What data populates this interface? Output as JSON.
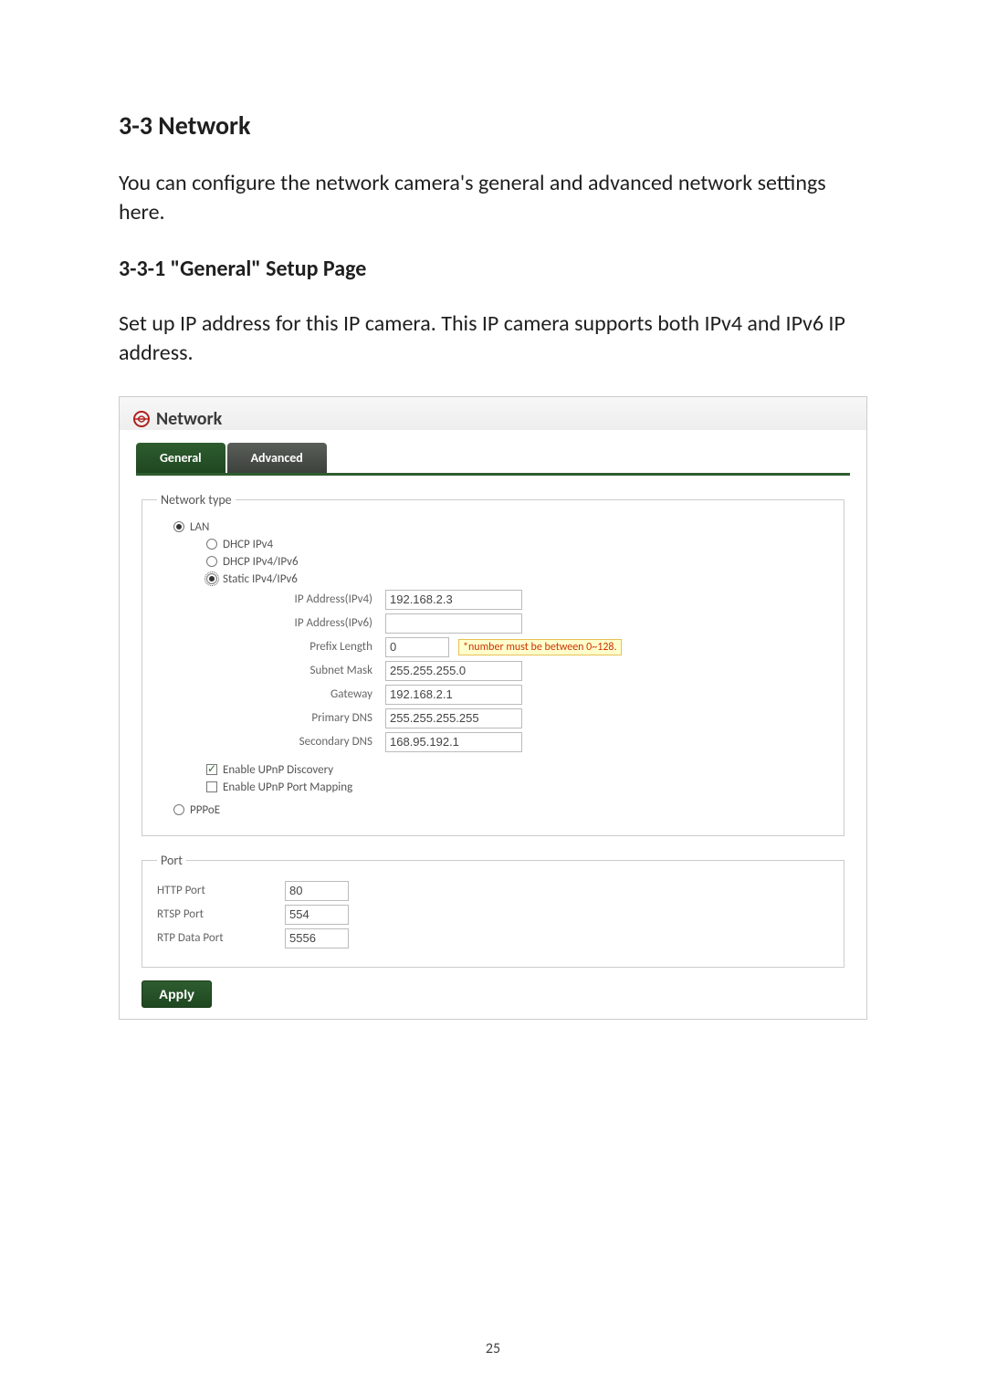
{
  "doc": {
    "section_heading": "3-3 Network",
    "intro": "You can configure the network camera's general and advanced network settings here.",
    "sub_heading": "3-3-1 \"General\" Setup Page",
    "sub_intro": "Set up IP address for this IP camera. This IP camera supports both IPv4 and IPv6 IP address.",
    "page_number": "25"
  },
  "panel": {
    "title": "Network",
    "tabs": {
      "general": "General",
      "advanced": "Advanced"
    }
  },
  "network_type": {
    "legend": "Network type",
    "lan": "LAN",
    "dhcp_ipv4": "DHCP IPv4",
    "dhcp_ipv4_ipv6": "DHCP IPv4/IPv6",
    "static_ipv4_ipv6": "Static IPv4/IPv6",
    "fields": {
      "ip_v4_label": "IP Address(IPv4)",
      "ip_v4_value": "192.168.2.3",
      "ip_v6_label": "IP Address(IPv6)",
      "ip_v6_value": "",
      "prefix_label": "Prefix Length",
      "prefix_value": "0",
      "prefix_hint": "*number must be between 0~128.",
      "subnet_label": "Subnet Mask",
      "subnet_value": "255.255.255.0",
      "gateway_label": "Gateway",
      "gateway_value": "192.168.2.1",
      "primary_dns_label": "Primary DNS",
      "primary_dns_value": "255.255.255.255",
      "secondary_dns_label": "Secondary DNS",
      "secondary_dns_value": "168.95.192.1"
    },
    "upnp_discovery": "Enable UPnP Discovery",
    "upnp_port_mapping": "Enable UPnP Port Mapping",
    "pppoe": "PPPoE"
  },
  "port": {
    "legend": "Port",
    "http_label": "HTTP Port",
    "http_value": "80",
    "rtsp_label": "RTSP Port",
    "rtsp_value": "554",
    "rtp_label": "RTP Data Port",
    "rtp_value": "5556"
  },
  "buttons": {
    "apply": "Apply"
  }
}
